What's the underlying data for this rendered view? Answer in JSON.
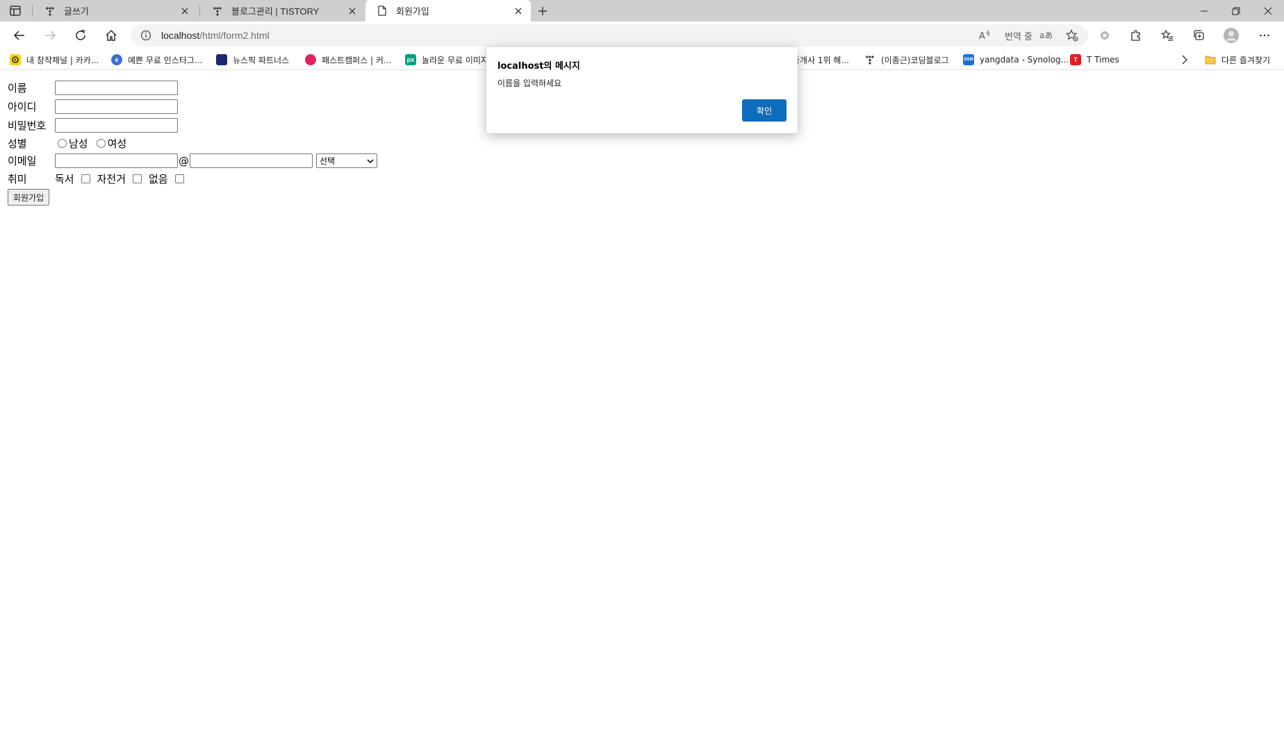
{
  "tabs": [
    {
      "label": "글쓰기",
      "icon": "tistory-icon"
    },
    {
      "label": "블로그관리 | TISTORY",
      "icon": "tistory-icon"
    },
    {
      "label": "회원가입",
      "icon": "page-icon"
    }
  ],
  "address": {
    "host": "localhost",
    "path": "/html/form2.html"
  },
  "address_actions": {
    "translate_label": "번역 중"
  },
  "bookmarks": [
    {
      "label": "내 창작채널 | 카카...",
      "color": "#f7d21c",
      "icon_text": ""
    },
    {
      "label": "예쁜 무료 인스타그...",
      "color": "#3c6fd8",
      "icon_text": "e"
    },
    {
      "label": "뉴스픽 파트너스",
      "color": "#1a2a6c",
      "icon_text": ""
    },
    {
      "label": "패스트캠퍼스 | 커...",
      "color": "#e0245e",
      "icon_text": ""
    },
    {
      "label": "놀라운 무료 이미지",
      "color": "#05a081",
      "icon_text": "px"
    },
    {
      "label": "중개사 1위 해...",
      "color": "#333333",
      "icon_text": ""
    },
    {
      "label": "(이종근)코딩블로그",
      "color": "#333333",
      "icon_text": ""
    },
    {
      "label": "yangdata - Synolog...",
      "color": "#1a6fd6",
      "icon_text": "DSM"
    },
    {
      "label": "T Times",
      "color": "#e02020",
      "icon_text": "T"
    }
  ],
  "other_bookmarks": "다른 즐겨찾기",
  "form": {
    "name_label": "이름",
    "id_label": "아이디",
    "password_label": "비밀번호",
    "gender_label": "성별",
    "male_label": "남성",
    "female_label": "여성",
    "email_label": "이메일",
    "email_at": "@",
    "domain_select": "선택",
    "hobby_label": "취미",
    "hobby_reading": "독서",
    "hobby_bike": "자전거",
    "hobby_none": "없음",
    "submit_label": "회원가입"
  },
  "dialog": {
    "title": "localhost의 메시지",
    "message": "이름을 입력하세요",
    "ok_label": "확인"
  },
  "colors": {
    "accent": "#0f6cbd",
    "tabstrip": "#cfcfcf"
  }
}
